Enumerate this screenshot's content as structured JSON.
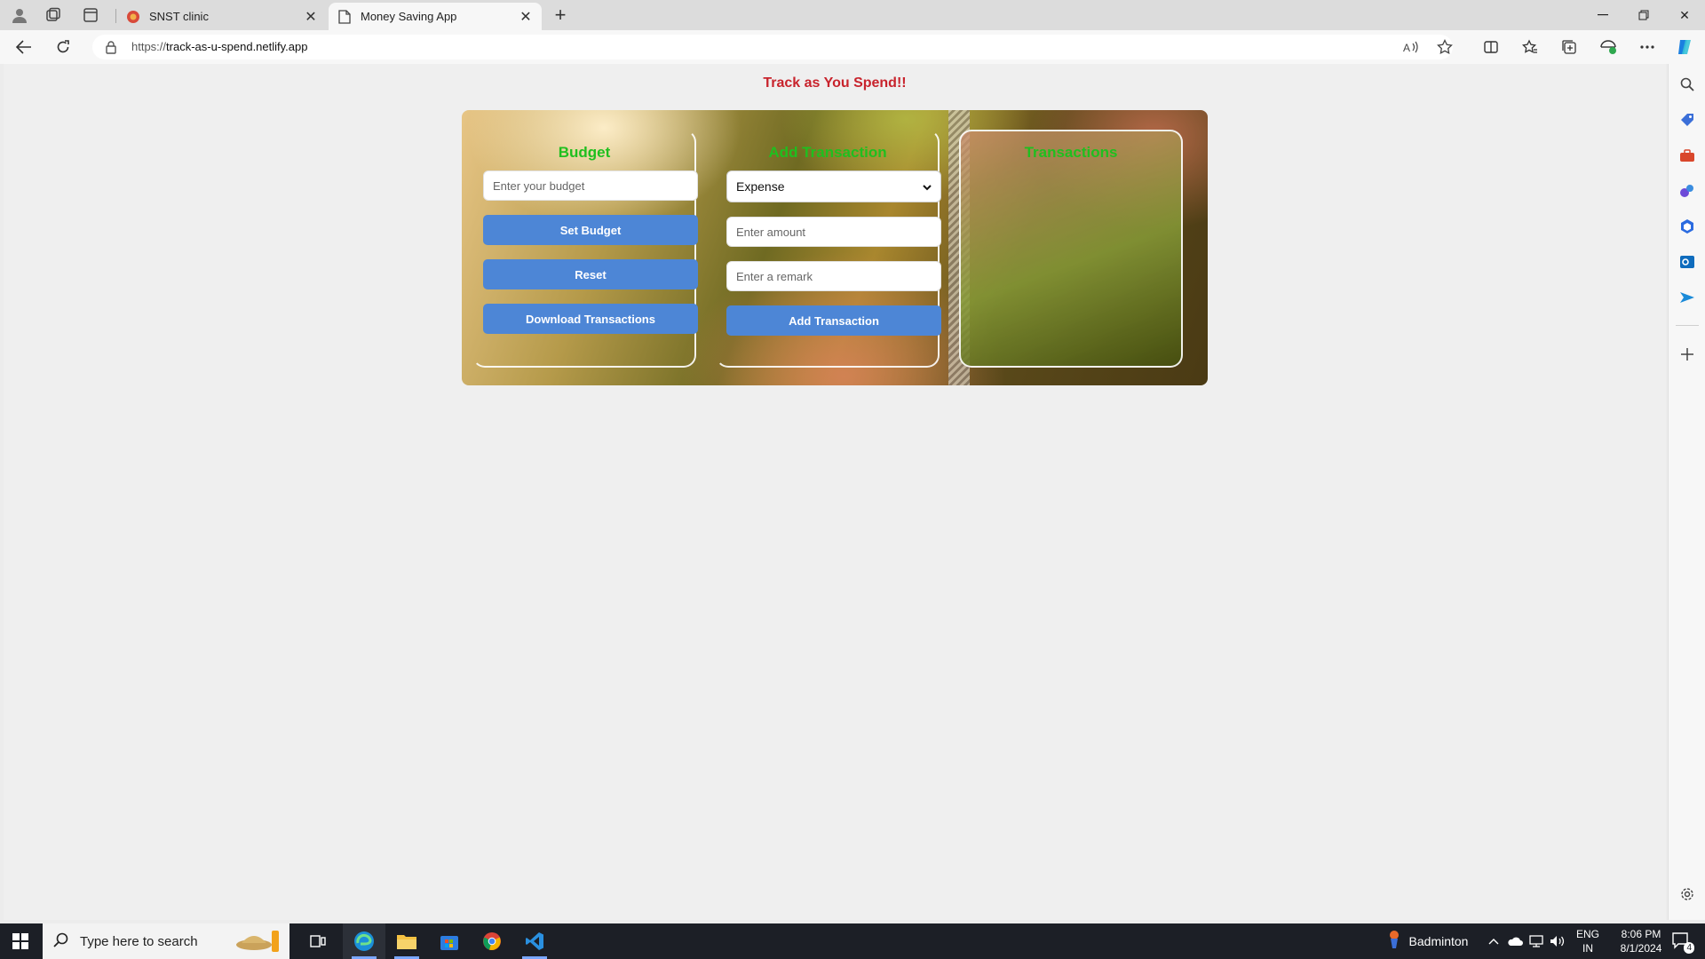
{
  "browser": {
    "tabs": [
      {
        "title": "SNST clinic",
        "active": false
      },
      {
        "title": "Money Saving App",
        "active": true
      }
    ],
    "url_prefix": "https://",
    "url_host": "track-as-u-spend.netlify.app"
  },
  "app": {
    "title": "Track as You Spend!!",
    "budget": {
      "heading": "Budget",
      "input_placeholder": "Enter your budget",
      "set_button": "Set Budget",
      "reset_button": "Reset",
      "download_button": "Download Transactions"
    },
    "add_transaction": {
      "heading": "Add Transaction",
      "type_selected": "Expense",
      "amount_placeholder": "Enter amount",
      "remark_placeholder": "Enter a remark",
      "add_button": "Add Transaction"
    },
    "transactions": {
      "heading": "Transactions"
    }
  },
  "taskbar": {
    "search_placeholder": "Type here to search",
    "weather_label": "Badminton",
    "lang_top": "ENG",
    "lang_bottom": "IN",
    "time": "8:06 PM",
    "date": "8/1/2024",
    "notification_count": "4"
  },
  "colors": {
    "title_red": "#c8232c",
    "heading_green": "#1fbf1f",
    "button_blue": "#4d86d6"
  }
}
